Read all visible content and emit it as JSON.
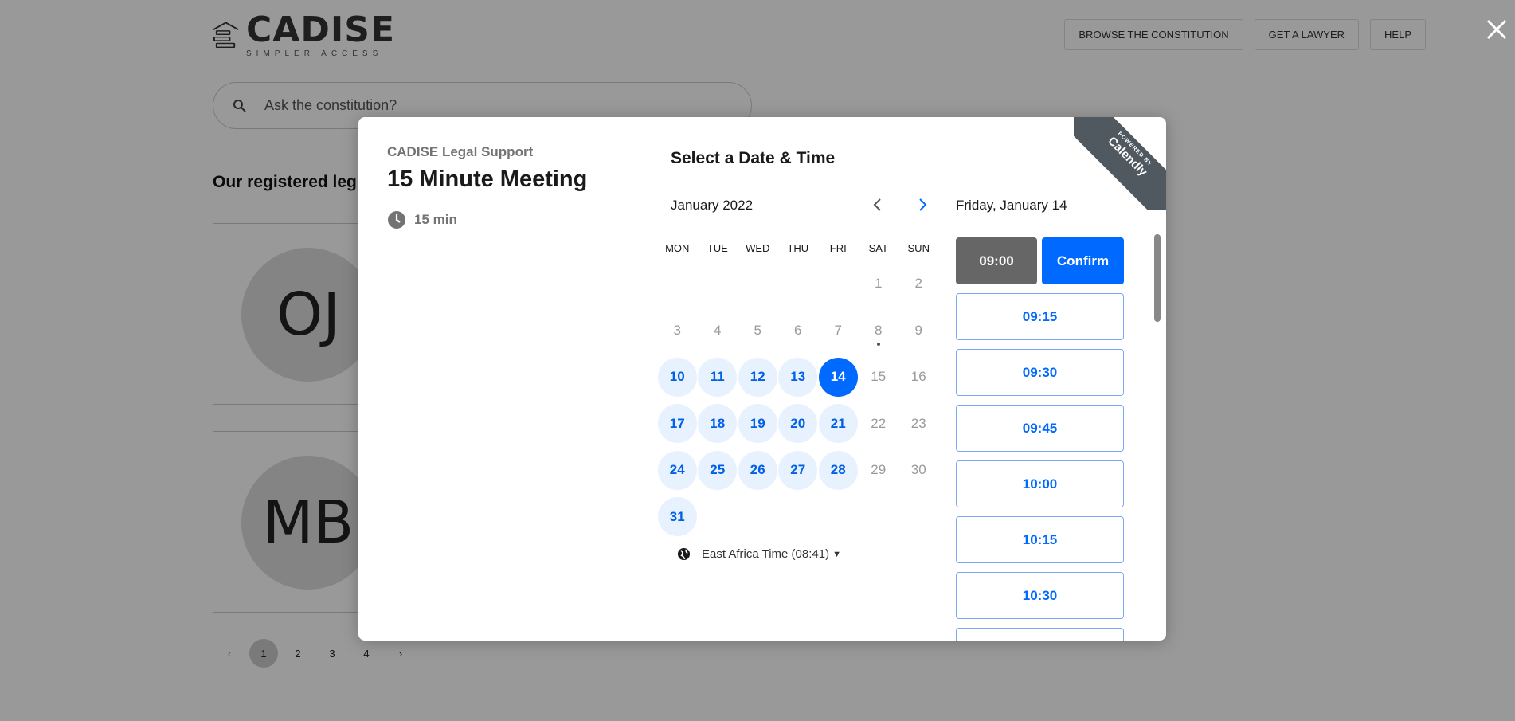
{
  "app": {
    "logo_name": "CADISE",
    "logo_tagline": "SIMPLER ACCESS",
    "nav": [
      "BROWSE THE CONSTITUTION",
      "GET A LAWYER",
      "HELP"
    ],
    "search_placeholder": "Ask the constitution?",
    "section_title": "Our registered lega",
    "cards": [
      {
        "initials": "OJ"
      },
      {
        "initials": "MB"
      }
    ],
    "pagination": {
      "prev": "‹",
      "pages": [
        "1",
        "2",
        "3",
        "4"
      ],
      "next": "›",
      "current": "1"
    }
  },
  "modal": {
    "organizer": "CADISE Legal Support",
    "event_name": "15 Minute Meeting",
    "duration": "15 min",
    "heading": "Select a Date & Time",
    "month_label": "January 2022",
    "weekdays": [
      "MON",
      "TUE",
      "WED",
      "THU",
      "FRI",
      "SAT",
      "SUN"
    ],
    "weeks": [
      [
        null,
        null,
        null,
        null,
        null,
        {
          "d": "1",
          "s": "off"
        },
        {
          "d": "2",
          "s": "off"
        }
      ],
      [
        {
          "d": "3",
          "s": "off"
        },
        {
          "d": "4",
          "s": "off"
        },
        {
          "d": "5",
          "s": "off"
        },
        {
          "d": "6",
          "s": "off"
        },
        {
          "d": "7",
          "s": "off"
        },
        {
          "d": "8",
          "s": "today"
        },
        {
          "d": "9",
          "s": "off"
        }
      ],
      [
        {
          "d": "10",
          "s": "avail"
        },
        {
          "d": "11",
          "s": "avail"
        },
        {
          "d": "12",
          "s": "avail"
        },
        {
          "d": "13",
          "s": "avail"
        },
        {
          "d": "14",
          "s": "selected"
        },
        {
          "d": "15",
          "s": "off"
        },
        {
          "d": "16",
          "s": "off"
        }
      ],
      [
        {
          "d": "17",
          "s": "avail"
        },
        {
          "d": "18",
          "s": "avail"
        },
        {
          "d": "19",
          "s": "avail"
        },
        {
          "d": "20",
          "s": "avail"
        },
        {
          "d": "21",
          "s": "avail"
        },
        {
          "d": "22",
          "s": "off"
        },
        {
          "d": "23",
          "s": "off"
        }
      ],
      [
        {
          "d": "24",
          "s": "avail"
        },
        {
          "d": "25",
          "s": "avail"
        },
        {
          "d": "26",
          "s": "avail"
        },
        {
          "d": "27",
          "s": "avail"
        },
        {
          "d": "28",
          "s": "avail"
        },
        {
          "d": "29",
          "s": "off"
        },
        {
          "d": "30",
          "s": "off"
        }
      ],
      [
        {
          "d": "31",
          "s": "avail"
        },
        null,
        null,
        null,
        null,
        null,
        null
      ]
    ],
    "timezone": "East Africa Time (08:41)",
    "selected_date_label": "Friday, January 14",
    "selected_time": "09:00",
    "confirm_label": "Confirm",
    "time_slots": [
      "09:15",
      "09:30",
      "09:45",
      "10:00",
      "10:15",
      "10:30",
      ""
    ],
    "ribbon": {
      "small": "POWERED BY",
      "big": "Calendly"
    }
  },
  "colors": {
    "accent": "#0069ff",
    "available_bg": "#e8f1fe",
    "chosen_slot": "#666666",
    "ribbon": "#505960"
  }
}
